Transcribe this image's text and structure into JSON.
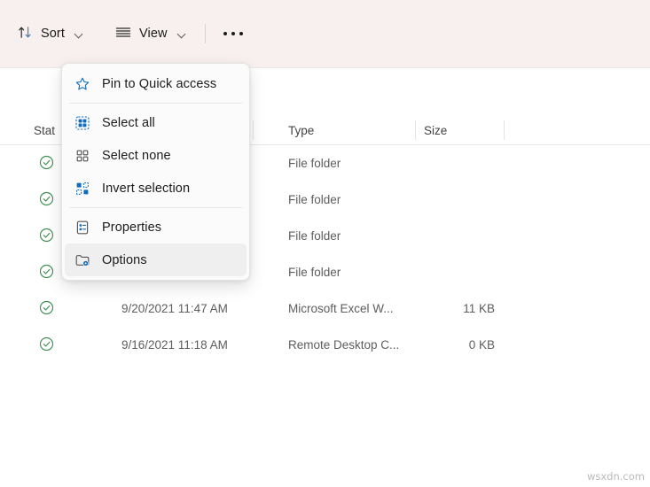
{
  "toolbar": {
    "sort": {
      "label": "Sort",
      "icon": "sort-arrows-icon"
    },
    "view": {
      "label": "View",
      "icon": "view-lines-icon"
    },
    "more": {
      "label": "",
      "icon": "ellipsis-icon"
    }
  },
  "menu": {
    "items": [
      {
        "label": "Pin to Quick access",
        "icon": "star-icon",
        "hover": false,
        "separator_after": true
      },
      {
        "label": "Select all",
        "icon": "select-all-icon",
        "hover": false,
        "separator_after": false
      },
      {
        "label": "Select none",
        "icon": "select-none-icon",
        "hover": false,
        "separator_after": false
      },
      {
        "label": "Invert selection",
        "icon": "invert-selection-icon",
        "hover": false,
        "separator_after": true
      },
      {
        "label": "Properties",
        "icon": "properties-icon",
        "hover": false,
        "separator_after": false
      },
      {
        "label": "Options",
        "icon": "folder-options-icon",
        "hover": true,
        "separator_after": false
      }
    ]
  },
  "file_list": {
    "columns": [
      {
        "label": "Stat",
        "full_label": "Status"
      },
      {
        "label": ""
      },
      {
        "label": "Type"
      },
      {
        "label": "Size"
      }
    ],
    "rows": [
      {
        "status": "synced-check-icon",
        "date": "",
        "type": "File folder",
        "size": ""
      },
      {
        "status": "synced-check-icon",
        "date": "",
        "type": "File folder",
        "size": ""
      },
      {
        "status": "synced-check-icon",
        "date": "",
        "type": "File folder",
        "size": ""
      },
      {
        "status": "synced-check-icon",
        "date": "",
        "type": "File folder",
        "size": ""
      },
      {
        "status": "synced-check-icon",
        "date": "9/20/2021 11:47 AM",
        "type": "Microsoft Excel W...",
        "size": "11 KB"
      },
      {
        "status": "synced-check-icon",
        "date": "9/16/2021 11:18 AM",
        "type": "Remote Desktop C...",
        "size": "0 KB"
      }
    ]
  },
  "watermark": {
    "text": "wsxdn.com"
  },
  "colors": {
    "toolbar_bg": "#f7f0ee",
    "menu_bg": "#fbfbfb",
    "hover_bg": "#efefef",
    "accent_blue": "#0f6cbd",
    "status_green": "#3f8f52",
    "text": "#1b1b1b",
    "muted_text": "#5d5d5d"
  }
}
